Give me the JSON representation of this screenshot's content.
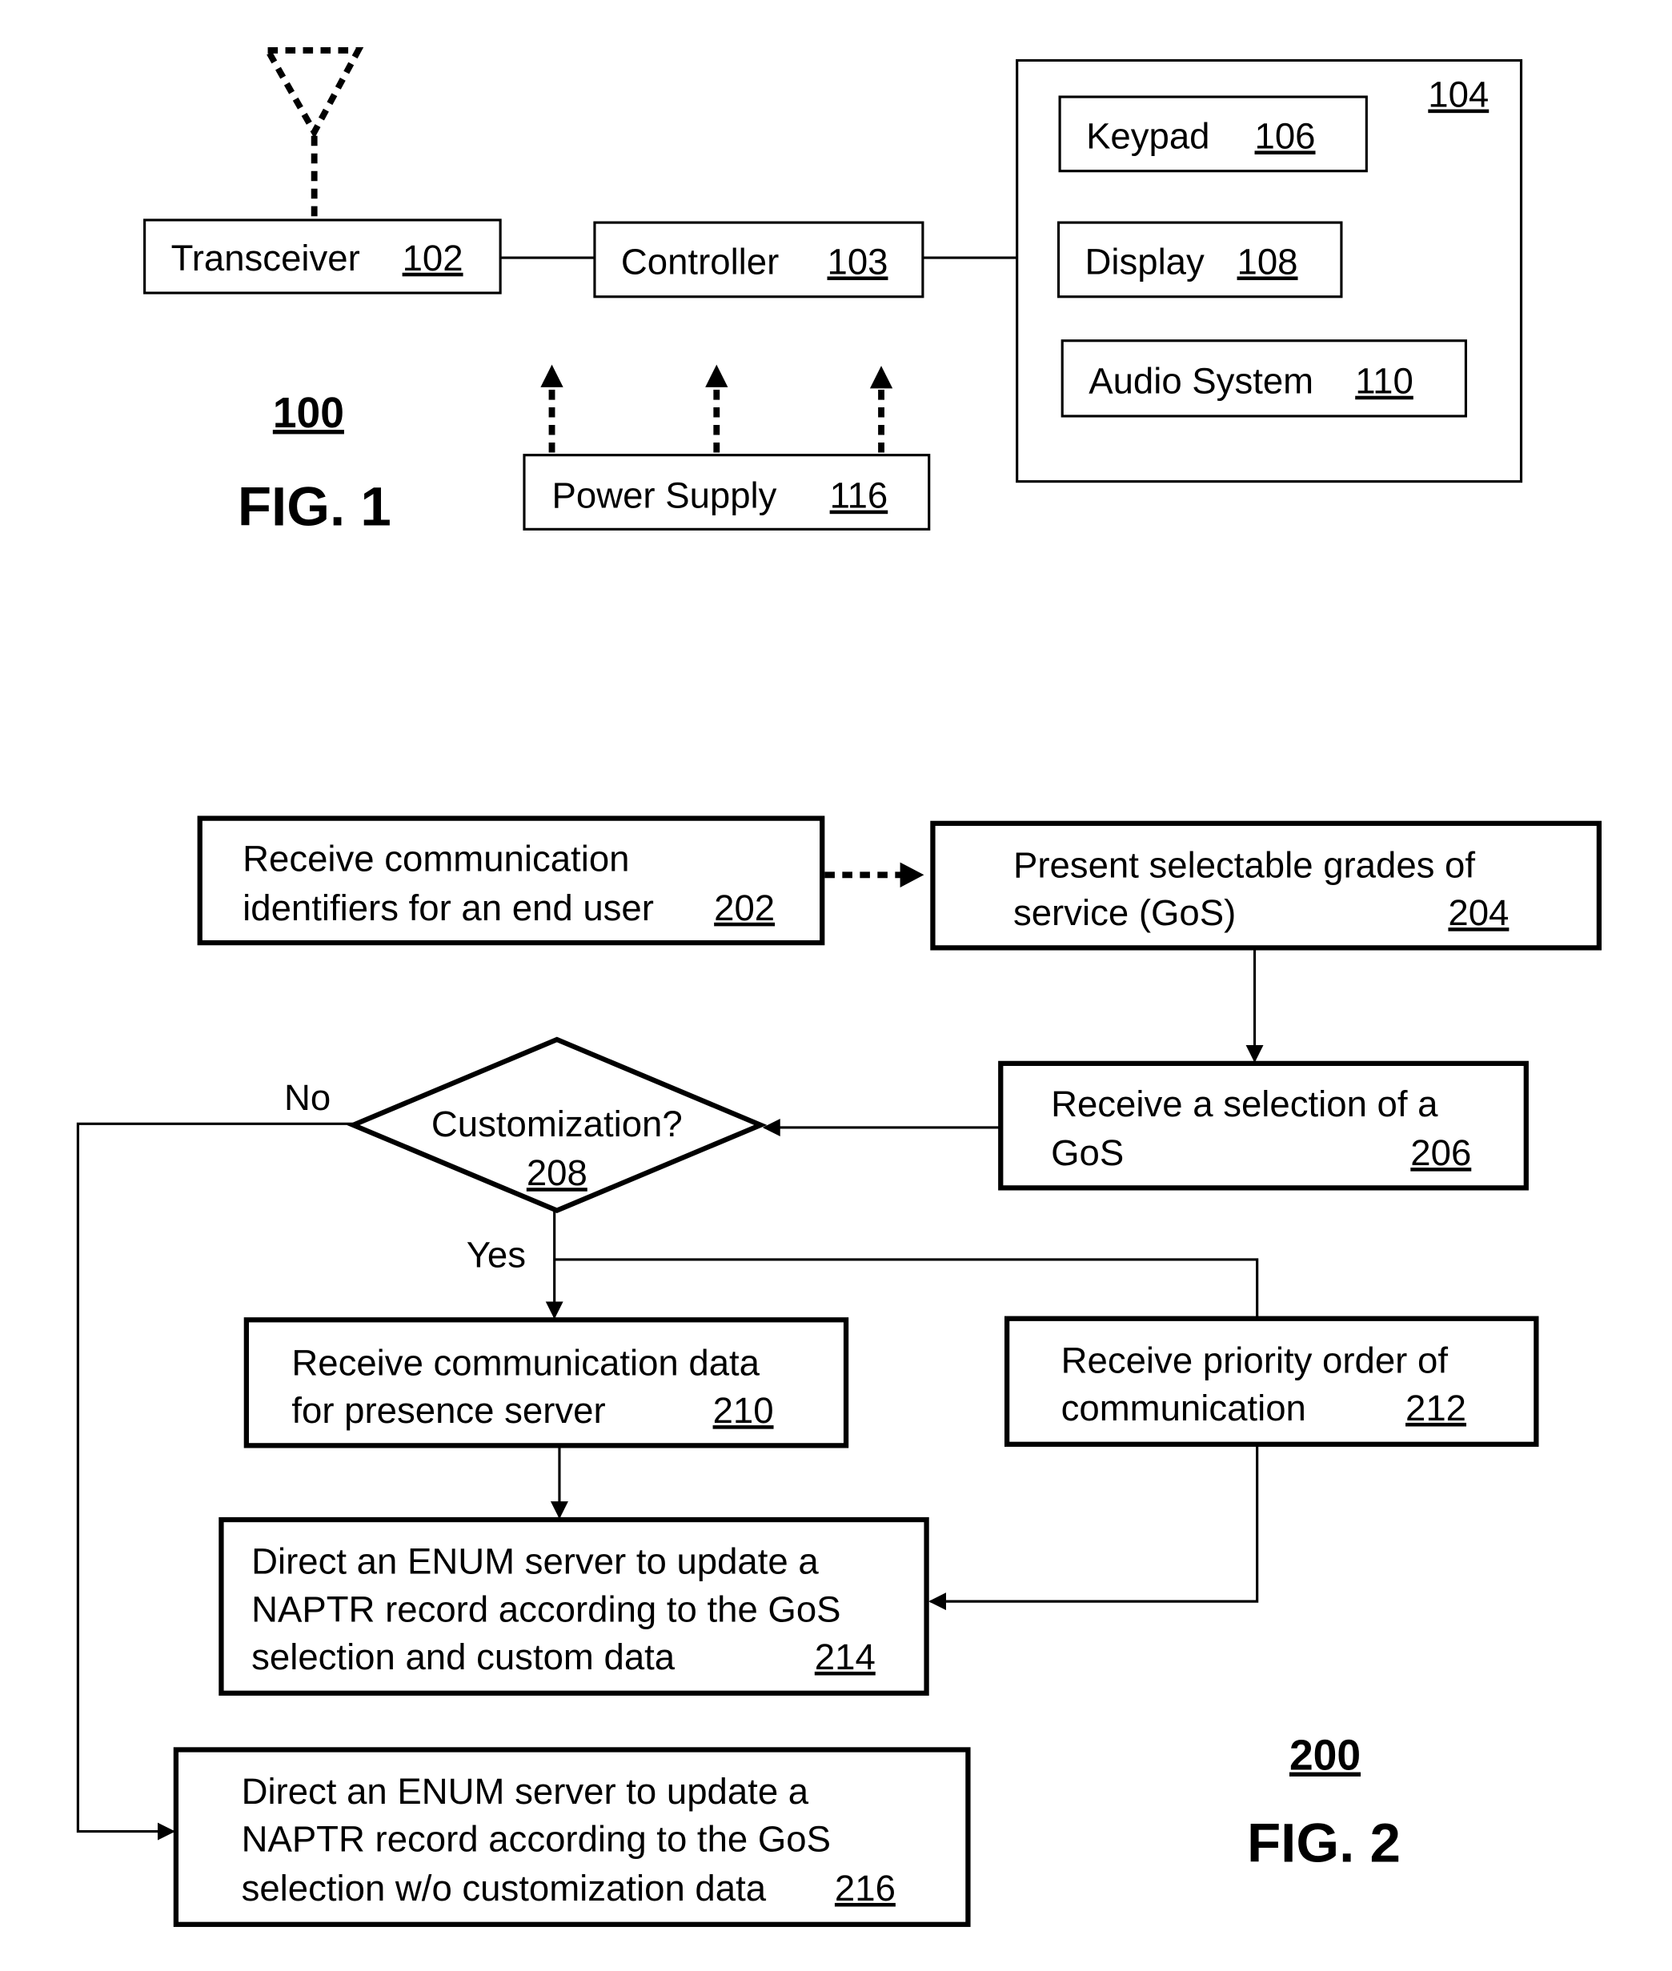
{
  "fig1": {
    "ref": "100",
    "title": "FIG. 1",
    "blocks": {
      "transceiver": {
        "label": "Transceiver",
        "ref": "102"
      },
      "controller": {
        "label": "Controller",
        "ref": "103"
      },
      "ui_group": {
        "ref": "104"
      },
      "keypad": {
        "label": "Keypad",
        "ref": "106"
      },
      "display": {
        "label": "Display",
        "ref": "108"
      },
      "audio": {
        "label": "Audio System",
        "ref": "110"
      },
      "power": {
        "label": "Power Supply",
        "ref": "116"
      }
    },
    "icons": {
      "antenna": "antenna-icon"
    }
  },
  "fig2": {
    "ref": "200",
    "title": "FIG. 2",
    "steps": {
      "s202": {
        "lines": [
          "Receive communication",
          "identifiers for an end user"
        ],
        "ref": "202"
      },
      "s204": {
        "lines": [
          "Present selectable grades of",
          "service (GoS)"
        ],
        "ref": "204"
      },
      "s206": {
        "lines": [
          "Receive a selection of a",
          "GoS"
        ],
        "ref": "206"
      },
      "s208": {
        "lines": [
          "Customization?"
        ],
        "ref": "208"
      },
      "s210": {
        "lines": [
          "Receive communication data",
          "for presence server"
        ],
        "ref": "210"
      },
      "s212": {
        "lines": [
          "Receive priority order of",
          "communication"
        ],
        "ref": "212"
      },
      "s214": {
        "lines": [
          "Direct an ENUM server to update a",
          "NAPTR record according to the GoS",
          "selection and custom data"
        ],
        "ref": "214"
      },
      "s216": {
        "lines": [
          "Direct an ENUM server to update a",
          "NAPTR record according to the GoS",
          "selection w/o customization data"
        ],
        "ref": "216"
      }
    },
    "branches": {
      "no": "No",
      "yes": "Yes"
    }
  }
}
